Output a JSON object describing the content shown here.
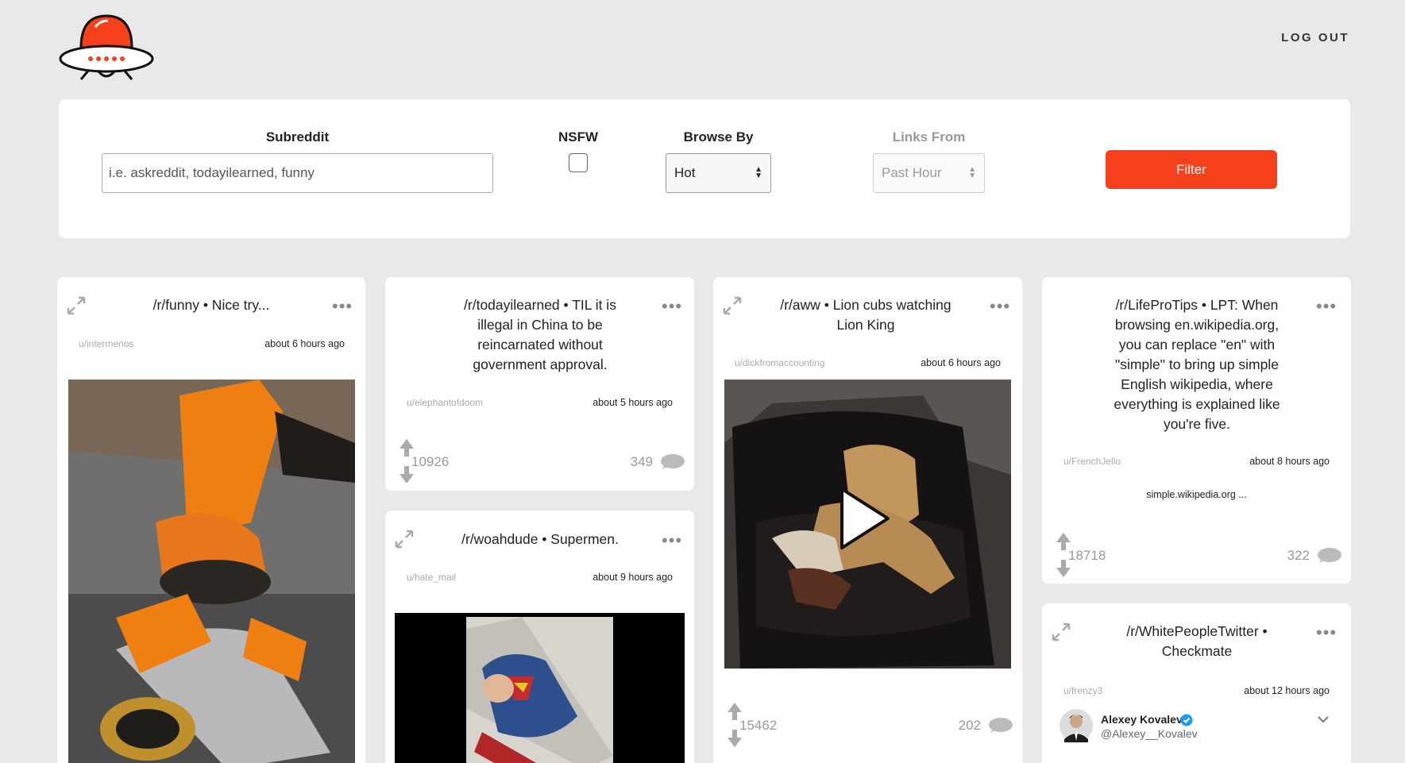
{
  "header": {
    "logout_label": "LOG OUT"
  },
  "filters": {
    "subreddit_label": "Subreddit",
    "subreddit_placeholder": "i.e. askreddit, todayilearned, funny",
    "nsfw_label": "NSFW",
    "nsfw_checked": false,
    "browse_by_label": "Browse By",
    "browse_by_value": "Hot",
    "links_from_label": "Links From",
    "links_from_value": "Past Hour",
    "filter_button_label": "Filter"
  },
  "posts": [
    {
      "title": "/r/funny • Nice try...",
      "author": "u/intermenos",
      "time": "about 6 hours ago"
    },
    {
      "title": "/r/todayilearned • TIL it is illegal in China to be reincarnated without government approval.",
      "author": "u/elephantofdoom",
      "time": "about 5 hours ago",
      "score": "10926",
      "comments": "349"
    },
    {
      "title": "/r/woahdude • Supermen.",
      "author": "u/hate_mail",
      "time": "about 9 hours ago"
    },
    {
      "title": "/r/aww • Lion cubs watching Lion King",
      "author": "u/dickfromaccounting",
      "time": "about 6 hours ago",
      "score": "15462",
      "comments": "202"
    },
    {
      "title": "/r/LifeProTips • LPT: When browsing en.wikipedia.org, you can replace \"en\" with \"simple\" to bring up simple English wikipedia, where everything is explained like you're five.",
      "author": "u/FrenchJello",
      "time": "about 8 hours ago",
      "link": "simple.wikipedia.org ...",
      "score": "18718",
      "comments": "322"
    },
    {
      "title": "/r/WhitePeopleTwitter • Checkmate",
      "author": "u/frenzy3",
      "time": "about 12 hours ago",
      "tweet_name": "Alexey Kovalev",
      "tweet_handle": "@Alexey__Kovalev"
    }
  ],
  "colors": {
    "accent": "#f6401c",
    "background": "#e9e9e9"
  },
  "icons": [
    "ufo-logo-icon",
    "expand-icon",
    "more-dots-icon",
    "upvote-icon",
    "downvote-icon",
    "comment-bubble-icon",
    "play-icon",
    "verified-icon",
    "chevron-down-icon"
  ]
}
